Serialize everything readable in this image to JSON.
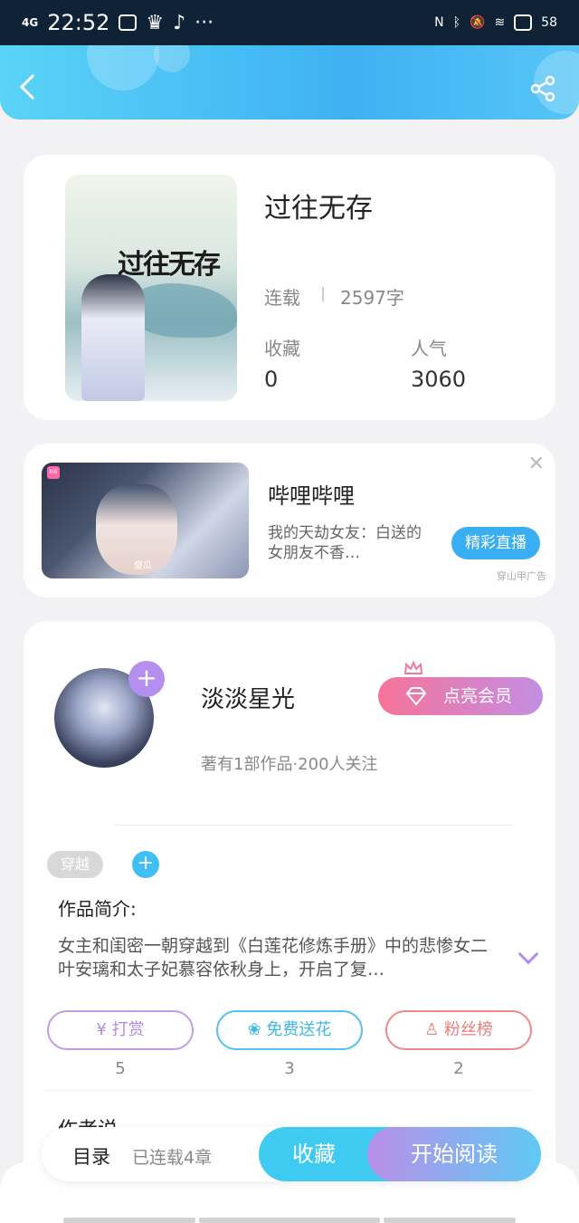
{
  "status_bar": {
    "network": "4G",
    "time": "22:52",
    "battery": "58"
  },
  "header": {
    "back_icon": "back-arrow-icon",
    "share_icon": "share-icon"
  },
  "book": {
    "cover_title": "过往无存",
    "title": "过往无存",
    "status": "连载",
    "word_count": "2597字",
    "favorites_label": "收藏",
    "favorites_value": "0",
    "popularity_label": "人气",
    "popularity_value": "3060"
  },
  "ad": {
    "thumb_watermark": "傻瓜",
    "brand": "哔哩哔哩",
    "description": "我的天劫女友：白送的女朋友不香…",
    "button": "精彩直播",
    "tag": "穿山甲广告"
  },
  "author": {
    "name": "淡淡星光",
    "vip_button": "点亮会员",
    "meta": "著有1部作品·200人关注",
    "tag": "穿越",
    "intro_title": "作品简介:",
    "intro_text": "女主和闺密一朝穿越到《白莲花修炼手册》中的悲惨女二叶安璃和太子妃慕容依秋身上，开启了复…",
    "actions": [
      {
        "label": "打赏",
        "count": "5",
        "color": "#c39ce6"
      },
      {
        "label": "免费送花",
        "count": "3",
        "color": "#4fc4ec"
      },
      {
        "label": "粉丝榜",
        "count": "2",
        "color": "#f08a8a"
      }
    ],
    "author_says": "作者说"
  },
  "bottom_bar": {
    "toc": "目录",
    "chapters": "已连载4章",
    "collect": "收藏",
    "start_reading": "开始阅读"
  }
}
